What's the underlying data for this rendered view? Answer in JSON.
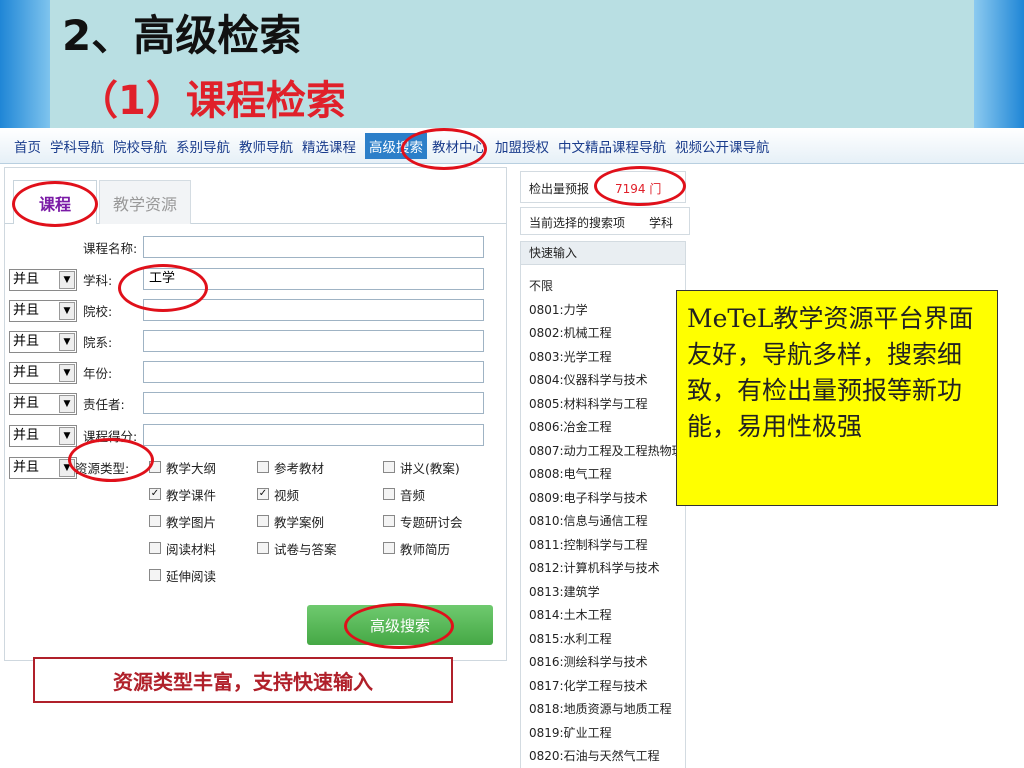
{
  "slide": {
    "title": "2、高级检索",
    "subtitle": "（1）课程检索"
  },
  "nav": {
    "items": [
      "首页",
      "学科导航",
      "院校导航",
      "系别导航",
      "教师导航",
      "精选课程",
      "高级搜索",
      "教材中心",
      "加盟授权",
      "中文精品课程导航",
      "视频公开课导航"
    ],
    "active_index": 6
  },
  "tabs": {
    "course": "课程",
    "resource": "教学资源"
  },
  "form": {
    "course_name_label": "课程名称:",
    "logic_value": "并且",
    "fields": [
      {
        "label": "学科:",
        "value": "工学"
      },
      {
        "label": "院校:",
        "value": ""
      },
      {
        "label": "院系:",
        "value": ""
      },
      {
        "label": "年份:",
        "value": ""
      },
      {
        "label": "责任者:",
        "value": ""
      },
      {
        "label": "课程得分:",
        "value": ""
      }
    ],
    "resource_type_label": "资源类型:",
    "checkboxes": [
      {
        "label": "教学大纲",
        "checked": false
      },
      {
        "label": "参考教材",
        "checked": false
      },
      {
        "label": "讲义(教案)",
        "checked": false
      },
      {
        "label": "教学课件",
        "checked": true
      },
      {
        "label": "视频",
        "checked": true
      },
      {
        "label": "音频",
        "checked": false
      },
      {
        "label": "教学图片",
        "checked": false
      },
      {
        "label": "教学案例",
        "checked": false
      },
      {
        "label": "专题研讨会",
        "checked": false
      },
      {
        "label": "阅读材料",
        "checked": false
      },
      {
        "label": "试卷与答案",
        "checked": false
      },
      {
        "label": "教师简历",
        "checked": false
      },
      {
        "label": "延伸阅读",
        "checked": false
      }
    ],
    "search_button": "高级搜索"
  },
  "caption": "资源类型丰富，支持快速输入",
  "right": {
    "count_label": "检出量预报",
    "count_value": "7194 门",
    "current_label": "当前选择的搜索项",
    "current_value": "学科",
    "quick_label": "快速输入",
    "quick_items": [
      "不限",
      "0801:力学",
      "0802:机械工程",
      "0803:光学工程",
      "0804:仪器科学与技术",
      "0805:材料科学与工程",
      "0806:冶金工程",
      "0807:动力工程及工程热物理",
      "0808:电气工程",
      "0809:电子科学与技术",
      "0810:信息与通信工程",
      "0811:控制科学与工程",
      "0812:计算机科学与技术",
      "0813:建筑学",
      "0814:土木工程",
      "0815:水利工程",
      "0816:测绘科学与技术",
      "0817:化学工程与技术",
      "0818:地质资源与地质工程",
      "0819:矿业工程",
      "0820:石油与天然气工程"
    ]
  },
  "note": "MeTeL教学资源平台界面友好，导航多样，搜索细致，有检出量预报等新功能，易用性极强",
  "colors": {
    "accent_red": "#e0101a",
    "nav_active": "#2c7fc9",
    "note_bg": "#ffff00",
    "button_green": "#45a845"
  }
}
